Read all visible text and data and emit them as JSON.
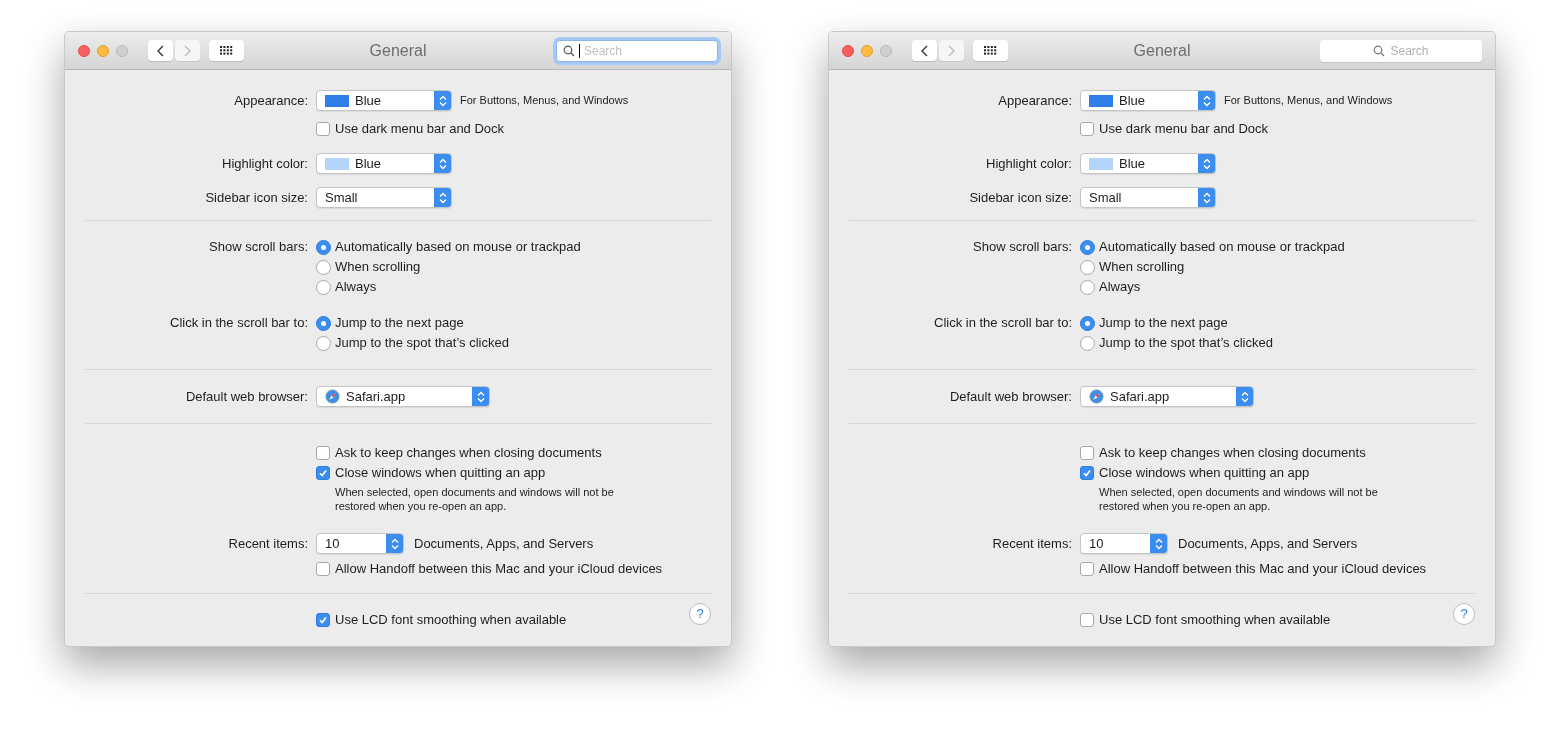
{
  "windows": [
    {
      "title": "General",
      "search": {
        "placeholder": "Search",
        "focused": true
      },
      "help": "?",
      "sections": [
        [
          {
            "kind": "popup",
            "label": "Appearance:",
            "value": "Blue",
            "color": "#2f7fe8",
            "note": "For Buttons, Menus, and Windows"
          },
          {
            "kind": "checkbox",
            "text": "Use dark menu bar and Dock",
            "checked": false
          },
          {
            "kind": "popup",
            "label": "Highlight color:",
            "value": "Blue",
            "color": "#b3d4fc"
          },
          {
            "kind": "popup",
            "label": "Sidebar icon size:",
            "value": "Small"
          }
        ],
        [
          {
            "kind": "radio",
            "label": "Show scroll bars:",
            "options": [
              {
                "text": "Automatically based on mouse or trackpad",
                "selected": true
              },
              {
                "text": "When scrolling",
                "selected": false
              },
              {
                "text": "Always",
                "selected": false
              }
            ]
          },
          {
            "kind": "radio",
            "label": "Click in the scroll bar to:",
            "options": [
              {
                "text": "Jump to the next page",
                "selected": true
              },
              {
                "text": "Jump to the spot that’s clicked",
                "selected": false
              }
            ]
          }
        ],
        [
          {
            "kind": "app_popup",
            "label": "Default web browser:",
            "value": "Safari.app"
          }
        ],
        [
          {
            "kind": "checkbox",
            "text": "Ask to keep changes when closing documents",
            "checked": false
          },
          {
            "kind": "checkbox",
            "text": "Close windows when quitting an app",
            "checked": true
          },
          {
            "kind": "note",
            "text": "When selected, open documents and windows will not be restored when you re-open an app."
          },
          {
            "kind": "count_popup",
            "label": "Recent items:",
            "value": "10",
            "trailing": "Documents, Apps, and Servers"
          },
          {
            "kind": "checkbox",
            "text": "Allow Handoff between this Mac and your iCloud devices",
            "checked": false
          }
        ],
        [
          {
            "kind": "checkbox",
            "text": "Use LCD font smoothing when available",
            "checked": true
          }
        ]
      ]
    },
    {
      "title": "General",
      "search": {
        "placeholder": "Search",
        "focused": false
      },
      "help": "?",
      "sections": [
        [
          {
            "kind": "popup",
            "label": "Appearance:",
            "value": "Blue",
            "color": "#2f7fe8",
            "note": "For Buttons, Menus, and Windows"
          },
          {
            "kind": "checkbox",
            "text": "Use dark menu bar and Dock",
            "checked": false
          },
          {
            "kind": "popup",
            "label": "Highlight color:",
            "value": "Blue",
            "color": "#b3d4fc"
          },
          {
            "kind": "popup",
            "label": "Sidebar icon size:",
            "value": "Small"
          }
        ],
        [
          {
            "kind": "radio",
            "label": "Show scroll bars:",
            "options": [
              {
                "text": "Automatically based on mouse or trackpad",
                "selected": true
              },
              {
                "text": "When scrolling",
                "selected": false
              },
              {
                "text": "Always",
                "selected": false
              }
            ]
          },
          {
            "kind": "radio",
            "label": "Click in the scroll bar to:",
            "options": [
              {
                "text": "Jump to the next page",
                "selected": true
              },
              {
                "text": "Jump to the spot that’s clicked",
                "selected": false
              }
            ]
          }
        ],
        [
          {
            "kind": "app_popup",
            "label": "Default web browser:",
            "value": "Safari.app"
          }
        ],
        [
          {
            "kind": "checkbox",
            "text": "Ask to keep changes when closing documents",
            "checked": false
          },
          {
            "kind": "checkbox",
            "text": "Close windows when quitting an app",
            "checked": true
          },
          {
            "kind": "note",
            "text": "When selected, open documents and windows will not be restored when you re-open an app."
          },
          {
            "kind": "count_popup",
            "label": "Recent items:",
            "value": "10",
            "trailing": "Documents, Apps, and Servers"
          },
          {
            "kind": "checkbox",
            "text": "Allow Handoff between this Mac and your iCloud devices",
            "checked": false
          }
        ],
        [
          {
            "kind": "checkbox",
            "text": "Use LCD font smoothing when available",
            "checked": false
          }
        ]
      ]
    }
  ]
}
